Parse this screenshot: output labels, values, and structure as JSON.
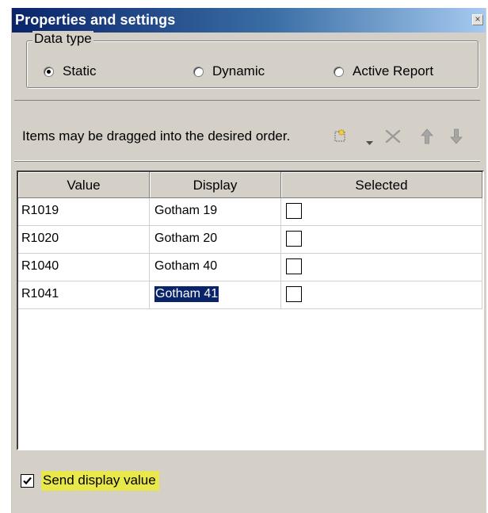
{
  "window": {
    "title": "Properties and settings",
    "close_glyph": "×"
  },
  "data_type": {
    "legend": "Data type",
    "options": [
      {
        "label": "Static",
        "checked": true
      },
      {
        "label": "Dynamic",
        "checked": false
      },
      {
        "label": "Active Report",
        "checked": false
      }
    ]
  },
  "toolbar": {
    "hint": "Items may be dragged into the desired order.",
    "icons": [
      "new-item-icon",
      "dropdown-arrow-icon",
      "delete-icon",
      "move-up-icon",
      "move-down-icon"
    ]
  },
  "grid": {
    "columns": [
      "Value",
      "Display",
      "Selected"
    ],
    "rows": [
      {
        "value": "R1019",
        "display": "Gotham 19",
        "selected": false
      },
      {
        "value": "R1020",
        "display": "Gotham 20",
        "selected": false
      },
      {
        "value": "R1040",
        "display": "Gotham 40",
        "selected": false
      },
      {
        "value": "R1041",
        "display": "Gotham 41",
        "selected": false,
        "editing": true
      }
    ]
  },
  "footer": {
    "send_display_label": "Send display value",
    "send_display_checked": true
  },
  "colors": {
    "title_start": "#0a246a",
    "title_end": "#a6caf0",
    "panel": "#d4d0c8",
    "highlight": "#e8e84a",
    "selection": "#0a246a"
  }
}
